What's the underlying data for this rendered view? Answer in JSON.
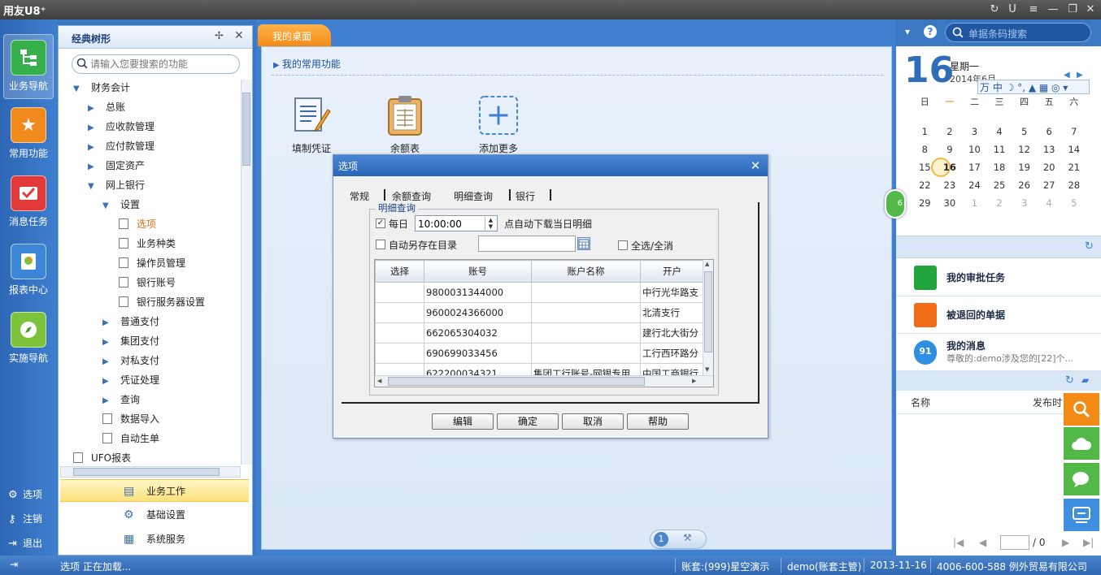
{
  "app": {
    "title": "用友U8⁺"
  },
  "window_controls": [
    "↻",
    "U",
    "≡",
    "—",
    "❐",
    "✕"
  ],
  "topbar": {
    "dropdown": "▾",
    "help": "?",
    "search_placeholder": "单据条码搜索"
  },
  "leftnav": {
    "items": [
      {
        "label": "业务导航",
        "icon": "org-chart-icon",
        "color": "#36b04a"
      },
      {
        "label": "常用功能",
        "icon": "star-icon",
        "color": "#f08a1c"
      },
      {
        "label": "消息任务",
        "icon": "mail-icon",
        "color": "#e23a3a"
      },
      {
        "label": "报表中心",
        "icon": "report-icon",
        "color": "#3b86d6"
      },
      {
        "label": "实施导航",
        "icon": "compass-icon",
        "color": "#7cc23a"
      }
    ],
    "links": [
      {
        "label": "选项",
        "icon": "gear-icon"
      },
      {
        "label": "注销",
        "icon": "key-icon"
      },
      {
        "label": "退出",
        "icon": "exit-icon"
      }
    ]
  },
  "tree": {
    "title": "经典树形",
    "search_placeholder": "请输入您要搜索的功能",
    "nodes": [
      {
        "label": "财务会计",
        "level": 0,
        "arrow": "down"
      },
      {
        "label": "总账",
        "level": 1,
        "arrow": "right"
      },
      {
        "label": "应收款管理",
        "level": 1,
        "arrow": "right"
      },
      {
        "label": "应付款管理",
        "level": 1,
        "arrow": "right"
      },
      {
        "label": "固定资产",
        "level": 1,
        "arrow": "right"
      },
      {
        "label": "网上银行",
        "level": 1,
        "arrow": "down"
      },
      {
        "label": "设置",
        "level": 2,
        "arrow": "down"
      },
      {
        "label": "选项",
        "level": 3,
        "doc": true,
        "selected": true
      },
      {
        "label": "业务种类",
        "level": 3,
        "doc": true
      },
      {
        "label": "操作员管理",
        "level": 3,
        "doc": true
      },
      {
        "label": "银行账号",
        "level": 3,
        "doc": true
      },
      {
        "label": "银行服务器设置",
        "level": 3,
        "doc": true
      },
      {
        "label": "普通支付",
        "level": 2,
        "arrow": "right"
      },
      {
        "label": "集团支付",
        "level": 2,
        "arrow": "right"
      },
      {
        "label": "对私支付",
        "level": 2,
        "arrow": "right"
      },
      {
        "label": "凭证处理",
        "level": 2,
        "arrow": "right"
      },
      {
        "label": "查询",
        "level": 2,
        "arrow": "right"
      },
      {
        "label": "数据导入",
        "level": 2,
        "doc": true
      },
      {
        "label": "自动生单",
        "level": 2,
        "doc": true
      },
      {
        "label": "UFO报表",
        "level": 0,
        "doc": true
      }
    ],
    "footer": [
      {
        "label": "业务工作",
        "active": true
      },
      {
        "label": "基础设置"
      },
      {
        "label": "系统服务"
      }
    ]
  },
  "desk": {
    "tab": "我的桌面",
    "common_title": "我的常用功能",
    "functions": [
      {
        "label": "填制凭证",
        "icon": "voucher-icon"
      },
      {
        "label": "余额表",
        "icon": "clipboard-icon"
      },
      {
        "label": "添加更多",
        "icon": "add-icon"
      }
    ],
    "page": "1"
  },
  "calendar": {
    "day": "16",
    "weekday": "星期一",
    "year_month": "2014年6月",
    "headers": [
      "日",
      "一",
      "二",
      "三",
      "四",
      "五",
      "六"
    ],
    "weeks": [
      [
        "1",
        "2",
        "3",
        "4",
        "5",
        "6",
        "7"
      ],
      [
        "8",
        "9",
        "10",
        "11",
        "12",
        "13",
        "14"
      ],
      [
        "15",
        "16",
        "17",
        "18",
        "19",
        "20",
        "21"
      ],
      [
        "22",
        "23",
        "24",
        "25",
        "26",
        "27",
        "28"
      ],
      [
        "29",
        "30",
        "1",
        "2",
        "3",
        "4",
        "5"
      ]
    ],
    "today": "16"
  },
  "ime": {
    "text": "万 中 ☽ °, ▲ ▦ ◎ ▾"
  },
  "tasks": [
    {
      "title": "我的审批任务",
      "icon": "briefcase-icon",
      "color": "#22a33c"
    },
    {
      "title": "被退回的单据",
      "icon": "document-icon",
      "color": "#f26b17"
    },
    {
      "title": "我的消息",
      "subtitle": "尊敬的:demo涉及您的[22]个...",
      "icon": "message-bubble-icon",
      "badge": "91",
      "color": "#2f8fe0"
    }
  ],
  "right_list": {
    "col_name": "名称",
    "col_time": "发布时",
    "page_sep": "/ 0"
  },
  "dialog": {
    "title": "选项",
    "tabs": [
      "常规",
      "余额查询",
      "明细查询",
      "银行"
    ],
    "group_title": "明细查询",
    "daily_label": "每日",
    "time_value": "10:00:00",
    "time_suffix": "点自动下载当日明细",
    "autosave_label": "自动另存在目录",
    "select_all_label": "全选/全消",
    "grid": {
      "headers": [
        "选择",
        "账号",
        "账户名称",
        "开户"
      ],
      "rows": [
        [
          "",
          "9800031344000",
          "",
          "中行光华路支"
        ],
        [
          "",
          "9600024366000",
          "",
          "北清支行"
        ],
        [
          "",
          "662065304032",
          "",
          "建行北大街分"
        ],
        [
          "",
          "690699033456",
          "",
          "工行西环路分"
        ],
        [
          "",
          "622200034321",
          "集团工行账号-网银专用",
          "中国工商银行"
        ]
      ]
    },
    "buttons": [
      "编辑",
      "确定",
      "取消",
      "帮助"
    ]
  },
  "status": {
    "left": "选项  正在加载...",
    "account": "账套:(999)星空演示",
    "user": "demo(账套主管)",
    "date": "2013-11-16",
    "company": "4006-600-588 例外贸易有限公司"
  }
}
